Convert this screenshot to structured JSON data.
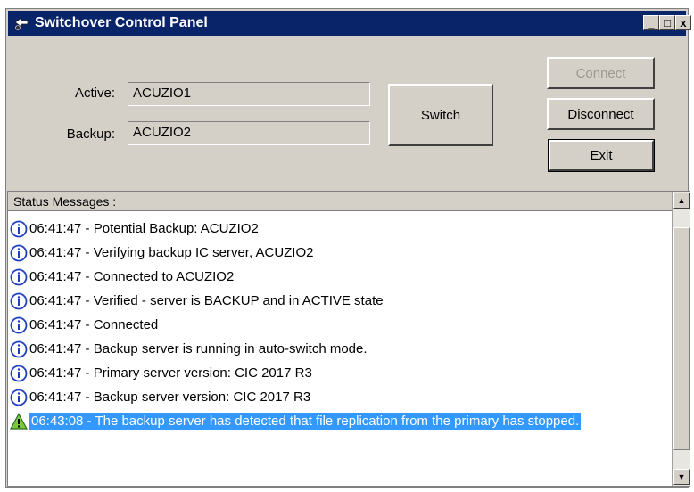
{
  "window": {
    "title": "Switchover Control Panel"
  },
  "titlebar_buttons": {
    "minimize": "_",
    "maximize": "□",
    "close": "x"
  },
  "servers": {
    "active_label": "Active:",
    "active_value": "ACUZIO1",
    "backup_label": "Backup:",
    "backup_value": "ACUZIO2"
  },
  "buttons": {
    "switch": "Switch",
    "connect": "Connect",
    "disconnect": "Disconnect",
    "exit": "Exit"
  },
  "status": {
    "header": "Status Messages :",
    "messages": [
      {
        "type": "info",
        "text": "06:41:47 - Potential Backup:  ACUZIO2"
      },
      {
        "type": "info",
        "text": "06:41:47 - Verifying backup IC server, ACUZIO2"
      },
      {
        "type": "info",
        "text": "06:41:47 - Connected to ACUZIO2"
      },
      {
        "type": "info",
        "text": "06:41:47 - Verified - server is BACKUP and in ACTIVE state"
      },
      {
        "type": "info",
        "text": "06:41:47 - Connected"
      },
      {
        "type": "info",
        "text": "06:41:47 - Backup server is running in auto-switch mode."
      },
      {
        "type": "info",
        "text": "06:41:47 - Primary server version: CIC 2017 R3"
      },
      {
        "type": "info",
        "text": "06:41:47 - Backup server version: CIC 2017 R3"
      },
      {
        "type": "warning",
        "text": "06:43:08 - The backup server has detected that file replication from the primary has stopped."
      }
    ]
  },
  "icons": {
    "app": "network-switch-icon",
    "info": "info-icon",
    "warning": "warning-icon"
  },
  "colors": {
    "titlebar": "#0a246a",
    "selection": "#3399ff",
    "info": "#1f3fbf",
    "warning": "#2e8b2e"
  }
}
